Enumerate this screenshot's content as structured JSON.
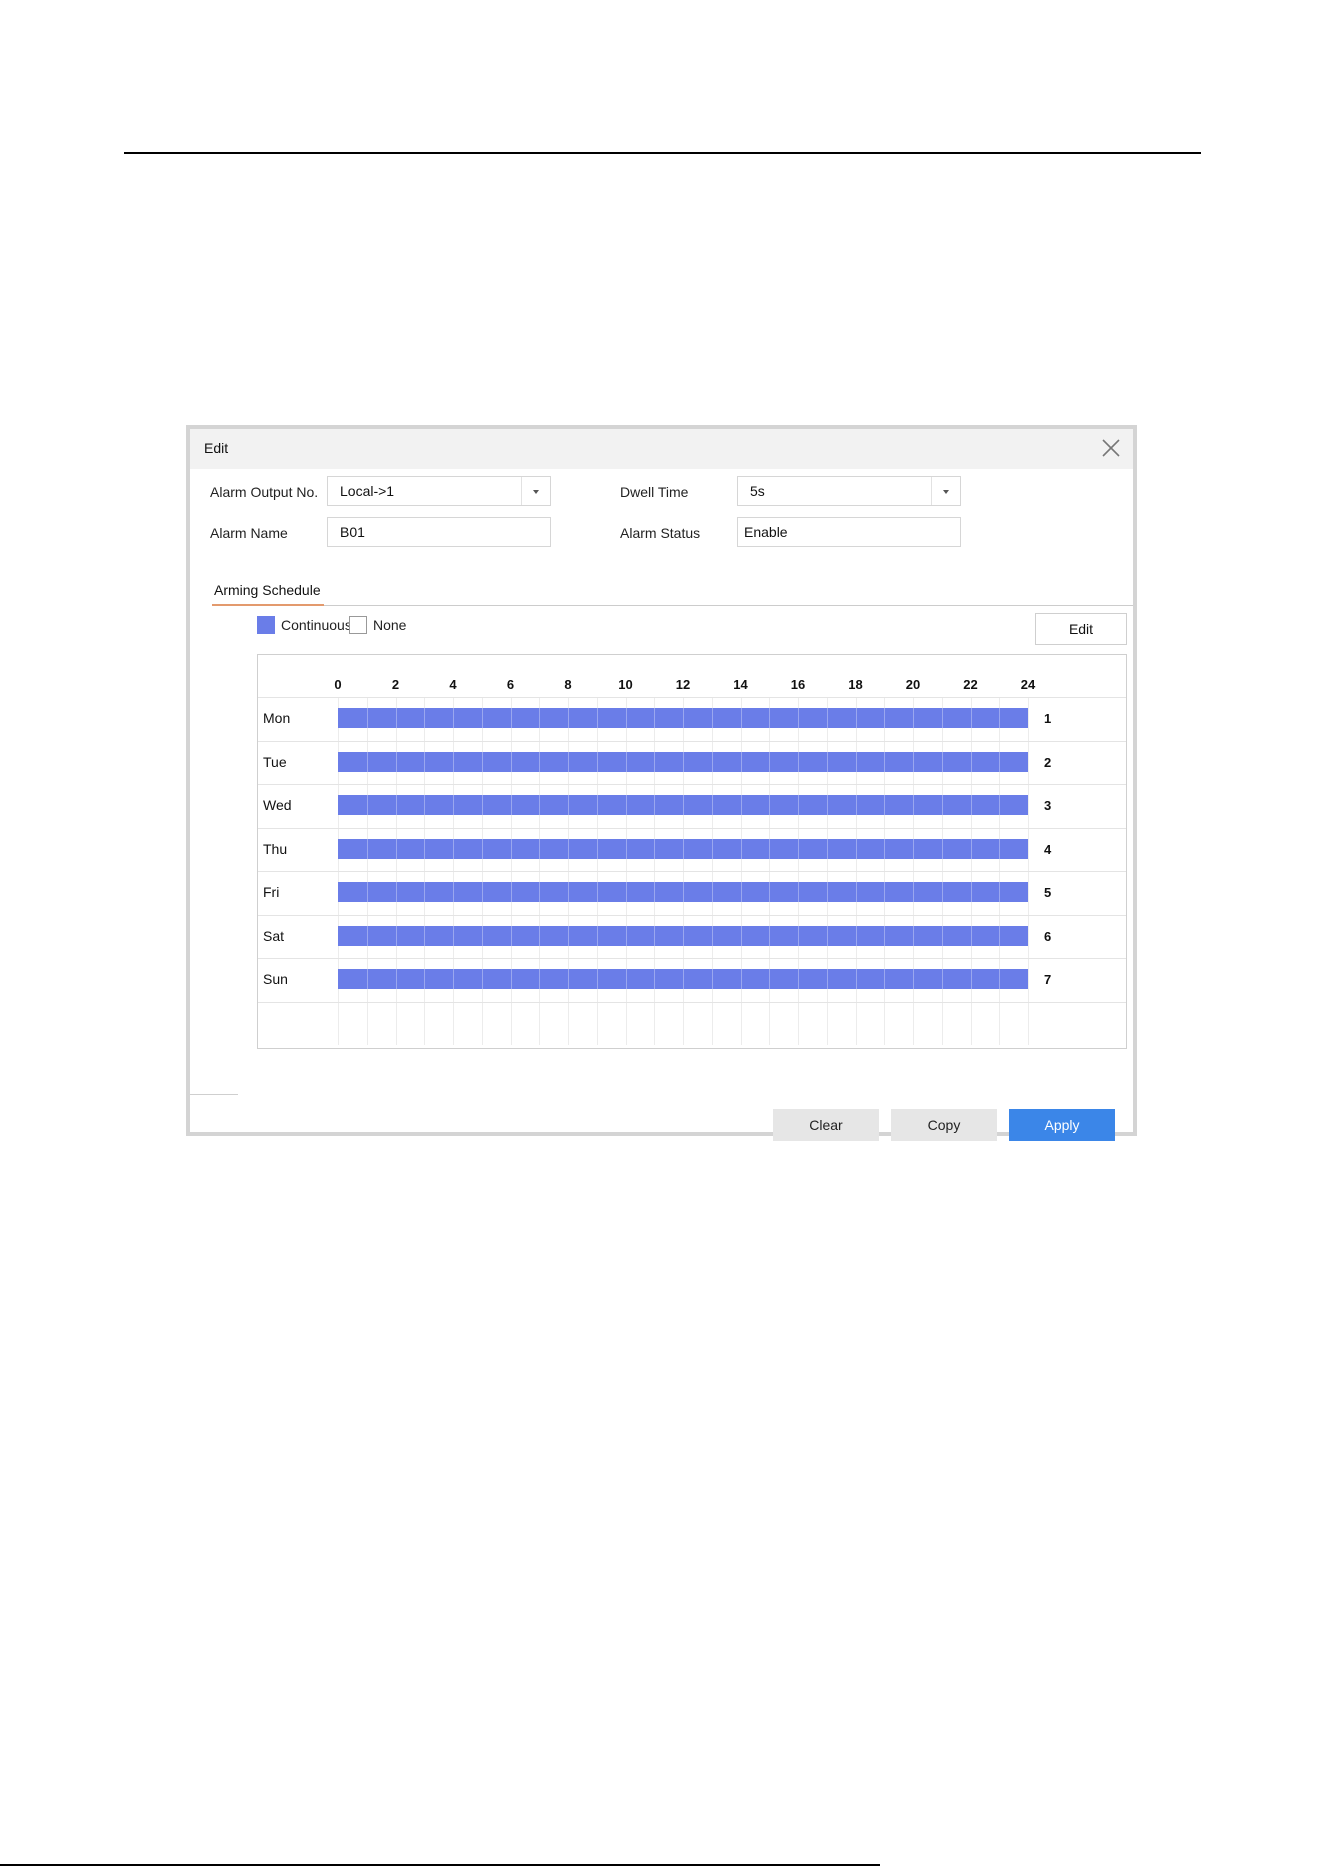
{
  "dialog": {
    "title": "Edit",
    "fields": {
      "alarm_output_label": "Alarm Output No.",
      "alarm_output_value": "Local->1",
      "alarm_name_label": "Alarm Name",
      "alarm_name_value": "B01",
      "dwell_time_label": "Dwell Time",
      "dwell_time_value": "5s",
      "alarm_status_label": "Alarm Status",
      "alarm_status_value": "Enable"
    },
    "tab": "Arming Schedule",
    "legend": {
      "continuous": "Continuous",
      "none": "None",
      "continuous_color": "#6a7de8"
    },
    "edit_label": "Edit",
    "schedule": {
      "hours": [
        "0",
        "2",
        "4",
        "6",
        "8",
        "10",
        "12",
        "14",
        "16",
        "18",
        "20",
        "22",
        "24"
      ],
      "days": [
        {
          "name": "Mon",
          "num": "1",
          "start": 0,
          "end": 24
        },
        {
          "name": "Tue",
          "num": "2",
          "start": 0,
          "end": 24
        },
        {
          "name": "Wed",
          "num": "3",
          "start": 0,
          "end": 24
        },
        {
          "name": "Thu",
          "num": "4",
          "start": 0,
          "end": 24
        },
        {
          "name": "Fri",
          "num": "5",
          "start": 0,
          "end": 24
        },
        {
          "name": "Sat",
          "num": "6",
          "start": 0,
          "end": 24
        },
        {
          "name": "Sun",
          "num": "7",
          "start": 0,
          "end": 24
        }
      ]
    },
    "buttons": {
      "clear": "Clear",
      "copy": "Copy",
      "apply": "Apply",
      "apply_color": "#3b86e8"
    }
  }
}
